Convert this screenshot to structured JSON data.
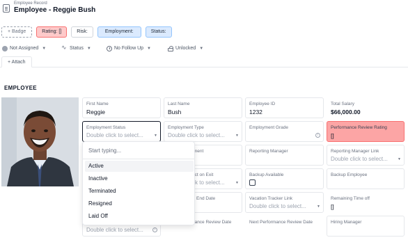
{
  "header": {
    "eyebrow": "Employee Record",
    "title": "Employee - Reggie Bush"
  },
  "badges": [
    {
      "label": "+ Badge"
    },
    {
      "label": "Rating: []"
    },
    {
      "label": "Risk:"
    },
    {
      "label": "Employment:"
    },
    {
      "label": "Status:"
    }
  ],
  "meta": {
    "assigned": "Not Assigned",
    "status": "Status",
    "follow_up": "No Follow Up",
    "lock": "Unlocked"
  },
  "tabs": {
    "attach": "+ Attach"
  },
  "section_title": "EMPLOYEE",
  "photo": {
    "alt_label": "Employee photo"
  },
  "fields": {
    "first_name": {
      "label": "First Name",
      "value": "Reggie"
    },
    "last_name": {
      "label": "Last Name",
      "value": "Bush"
    },
    "employee_id": {
      "label": "Employee ID",
      "value": "1232"
    },
    "total_salary": {
      "label": "Total Salary",
      "value": "$66,000.00"
    },
    "employment_status": {
      "label": "Employment Status",
      "placeholder": "Double click to select..."
    },
    "employment_type": {
      "label": "Employment Type",
      "placeholder": "Double click to select..."
    },
    "employment_grade": {
      "label": "Employment Grade"
    },
    "performance_review_rating": {
      "label": "Performance Review Rating",
      "value": "[]"
    },
    "department_partial": {
      "label": "tment"
    },
    "reporting_manager": {
      "label": "Reporting Manager"
    },
    "reporting_manager_link": {
      "label": "Reporting Manager Link",
      "placeholder": "Double click to select..."
    },
    "effect_on_exit_partial": {
      "label": "ect on Exit",
      "placeholder": "ck to select..."
    },
    "backup_available": {
      "label": "Backup Available"
    },
    "backup_employee": {
      "label": "Backup Employee"
    },
    "end_date_partial": {
      "label": "End Date"
    },
    "vacation_tracker_link": {
      "label": "Vacation Tracker Link",
      "placeholder": "Double click to select..."
    },
    "remaining_time_off": {
      "label": "Remaining Time off",
      "value": "[]"
    },
    "hidden_select": {
      "placeholder": "Double click to select..."
    },
    "perf_review_date_partial": {
      "label": "rmance Review Date"
    },
    "next_perf_review_date": {
      "label": "Next Performance Review Date"
    },
    "hiring_manager": {
      "label": "Hiring Manager"
    }
  },
  "dropdown": {
    "search_placeholder": "Start typing...",
    "options": [
      "Active",
      "Inactive",
      "Terminated",
      "Resigned",
      "Laid Off"
    ],
    "highlighted": "Active"
  },
  "colors": {
    "pink_badge": "#fecaca",
    "blue_badge": "#dbeafe",
    "pink_field": "#fca5a5"
  }
}
